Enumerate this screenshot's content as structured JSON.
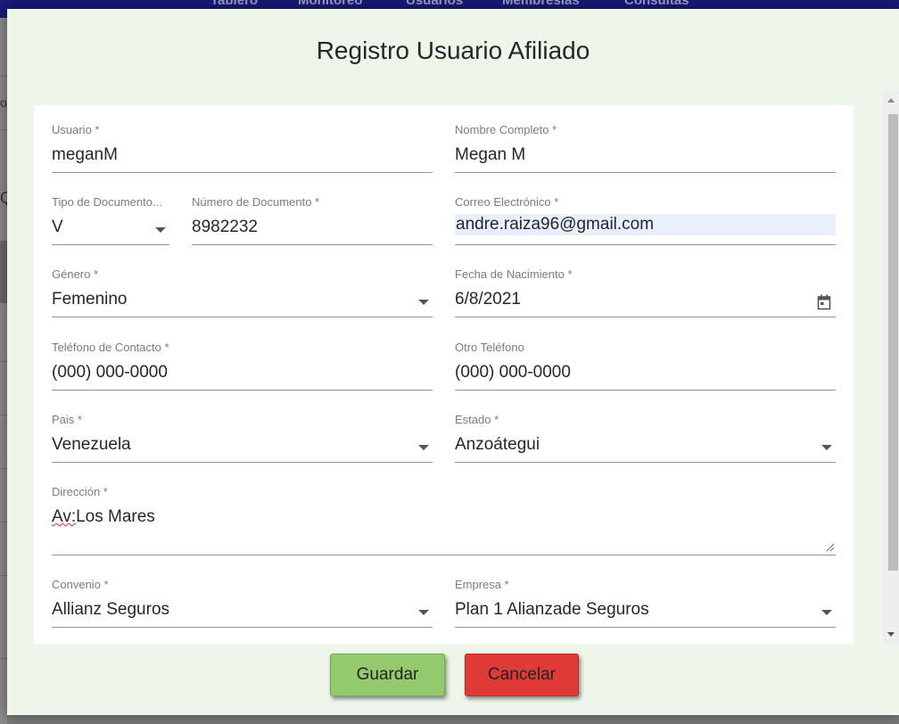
{
  "background": {
    "nav_items": [
      "Tablero",
      "Monitoreo",
      "Usuarios",
      "Membresías",
      "Consultas"
    ],
    "fragments": [
      "o",
      "Q"
    ]
  },
  "dialog": {
    "title": "Registro Usuario Afiliado",
    "fields": {
      "usuario": {
        "label": "Usuario *",
        "value": "meganM"
      },
      "nombre": {
        "label": "Nombre Completo *",
        "value": "Megan M"
      },
      "tipo_doc": {
        "label": "Tipo de Documento...",
        "value": "V"
      },
      "num_doc": {
        "label": "Número de Documento *",
        "value": "8982232"
      },
      "correo": {
        "label": "Correo Electrónico *",
        "value": "andre.raiza96@gmail.com"
      },
      "genero": {
        "label": "Género *",
        "value": "Femenino"
      },
      "fecha": {
        "label": "Fecha de Nacimiento *",
        "value": "6/8/2021"
      },
      "telefono": {
        "label": "Teléfono de Contacto *",
        "value": "(000) 000-0000"
      },
      "otro_tel": {
        "label": "Otro Teléfono",
        "value": "(000) 000-0000"
      },
      "pais": {
        "label": "Pais *",
        "value": "Venezuela"
      },
      "estado": {
        "label": "Estado *",
        "value": "Anzoátegui"
      },
      "direccion": {
        "label": "Dirección *",
        "value_prefix": "Av:",
        "value_rest": "Los Mares"
      },
      "convenio": {
        "label": "Convenio *",
        "value": "Allianz Seguros"
      },
      "empresa": {
        "label": "Empresa *",
        "value": "Plan 1 Alianzade Seguros"
      }
    },
    "buttons": {
      "save": "Guardar",
      "cancel": "Cancelar"
    }
  },
  "colors": {
    "dialog_bg": "#eef6ea",
    "save": "#94c96d",
    "cancel": "#e03a37",
    "nav": "#1a1a7a"
  }
}
